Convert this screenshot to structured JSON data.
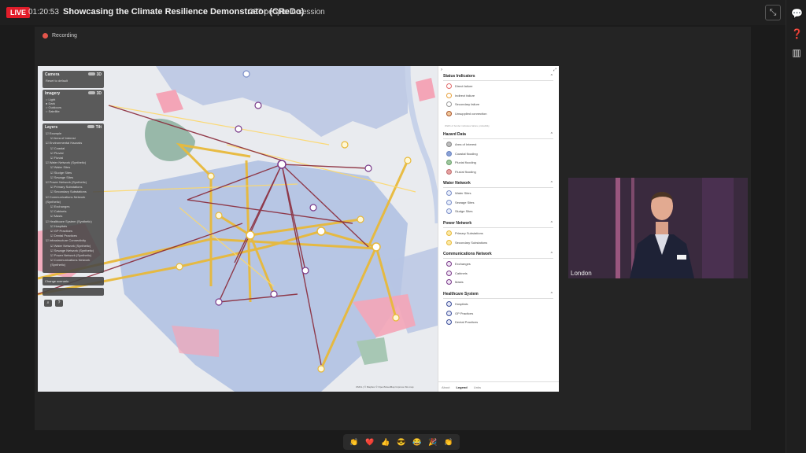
{
  "topbar": {
    "live": "LIVE",
    "timer": "01:20:53",
    "title": "Showcasing the Climate Resilience Demonstrator (CReDo)",
    "attendees": "237 people in session"
  },
  "stage": {
    "recording": "Recording"
  },
  "map_controls": {
    "camera": {
      "title": "Camera",
      "toggle": "3D",
      "reset": "Reset to default"
    },
    "imagery": {
      "title": "Imagery",
      "toggle": "3D",
      "options": [
        "Light",
        "Dark",
        "Outdoors",
        "Satellite"
      ]
    },
    "layers": {
      "title": "Layers",
      "toggle": "Tilt",
      "items": [
        "Example",
        "Area of Interest",
        "Environmental Hazards",
        "Coastal",
        "Pluvial",
        "Fluvial",
        "Water Network (Synthetic)",
        "Water Sites",
        "Sludge Sites",
        "Sewage Sites",
        "Power Network (Synthetic)",
        "Primary Substations",
        "Secondary Substations",
        "Communications Network (Synthetic)",
        "Exchanges",
        "Cabinets",
        "Masts",
        "Healthcare System (Synthetic)",
        "Hospitals",
        "GP Practices",
        "Dental Practices",
        "Infrastructure Connectivity",
        "Water Network (Synthetic)",
        "Sewage Network (Synthetic)",
        "Power Network (Synthetic)",
        "Communications Network (Synthetic)"
      ]
    },
    "change_scenario": "Change scenario",
    "attribution": "CMCL | © Mapbox © OpenStreetMap Improve this map"
  },
  "legend": {
    "status": {
      "title": "Status Indicators",
      "items": [
        "Direct failure",
        "Indirect failure",
        "Secondary failure",
        "Unsupplied connection"
      ],
      "note": "Width of border indicates failure probability"
    },
    "hazard": {
      "title": "Hazard Data",
      "items": [
        "Area of Interest",
        "Coastal flooding",
        "Pluvial flooding",
        "Fluvial flooding"
      ]
    },
    "water": {
      "title": "Water Network",
      "items": [
        "Water Sites",
        "Sewage Sites",
        "Sludge Sites"
      ]
    },
    "power": {
      "title": "Power Network",
      "items": [
        "Primary Substations",
        "Secondary Substations"
      ]
    },
    "comms": {
      "title": "Communications Network",
      "items": [
        "Exchanges",
        "Cabinets",
        "Masts"
      ]
    },
    "health": {
      "title": "Healthcare System",
      "items": [
        "Hospitals",
        "GP Practices",
        "Dental Practices"
      ]
    },
    "tabs": [
      "About",
      "Legend",
      "Links"
    ]
  },
  "video": {
    "label": "London"
  },
  "reactions": [
    "👏",
    "❤️",
    "👍",
    "😎",
    "😂",
    "🎉",
    "👏"
  ],
  "colors": {
    "live": "#e11d2a",
    "power": "#e8b93a",
    "link": "#8a2a3a",
    "flood": "#f2a3b3",
    "water": "#b7c6e6"
  }
}
